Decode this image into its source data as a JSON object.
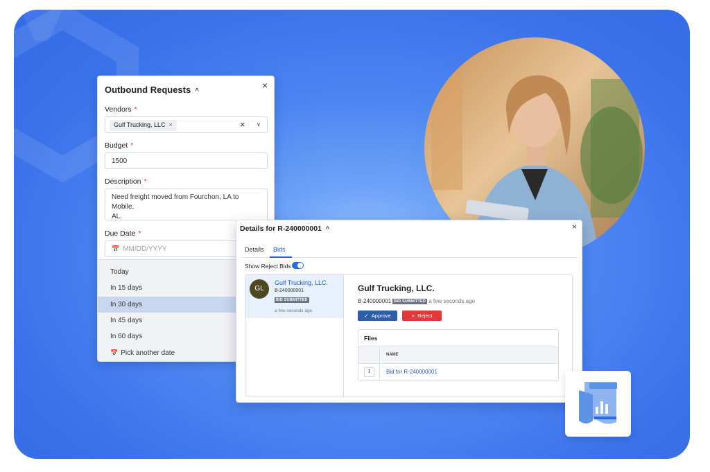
{
  "outbound": {
    "title": "Outbound Requests",
    "vendors_label": "Vendors",
    "vendor_chip": "Gulf Trucking, LLC",
    "budget_label": "Budget",
    "budget_value": "1500",
    "description_label": "Description",
    "description_line1": "Need freight moved from Fourchon, LA to Mobile,",
    "description_line2": "AL.",
    "due_date_label": "Due Date",
    "due_date_placeholder": "MM/DD/YYYY",
    "required_mark": "*",
    "date_options": [
      "Today",
      "In 15 days",
      "In 30 days",
      "In 45 days",
      "In 60 days",
      "Pick another date"
    ],
    "selected_option": "In 30 days"
  },
  "details": {
    "title": "Details for R-240000001",
    "tabs": [
      "Details",
      "Bids"
    ],
    "active_tab": "Bids",
    "show_reject_label": "Show Reject Bids",
    "show_reject_on": true,
    "bid_card": {
      "initials": "GL",
      "vendor": "Gulf Trucking, LLC.",
      "bid_id": "B-240000001",
      "status": "BID SUBMITTED",
      "time": "a few seconds ago"
    },
    "detail": {
      "vendor": "Gulf Trucking, LLC.",
      "bid_id": "B-240000001",
      "status": "BID SUBMITTED",
      "time": "a few seconds ago",
      "approve_label": "Approve",
      "reject_label": "Reject",
      "files_title": "Files",
      "files_col_name": "NAME",
      "file_name": "Bid for R-240000001"
    }
  },
  "colors": {
    "accent": "#2b6be0",
    "approve": "#2f5ea8",
    "reject": "#e0383b",
    "link": "#2b5ab8",
    "background": "#3a72ea"
  }
}
